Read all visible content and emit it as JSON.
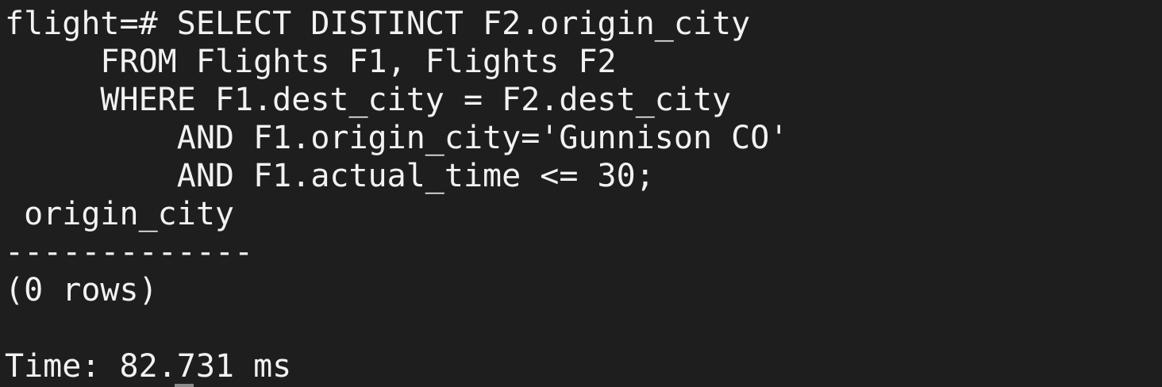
{
  "terminal": {
    "prompt": "flight=# ",
    "query_lines": [
      "SELECT DISTINCT F2.origin_city",
      "     FROM Flights F1, Flights F2",
      "     WHERE F1.dest_city = F2.dest_city",
      "         AND F1.origin_city='Gunnison CO'",
      "         AND F1.actual_time <= 30;"
    ],
    "result": {
      "header": " origin_city",
      "separator": "-------------",
      "rows_summary": "(0 rows)"
    },
    "timing": "Time: 82.731 ms"
  }
}
